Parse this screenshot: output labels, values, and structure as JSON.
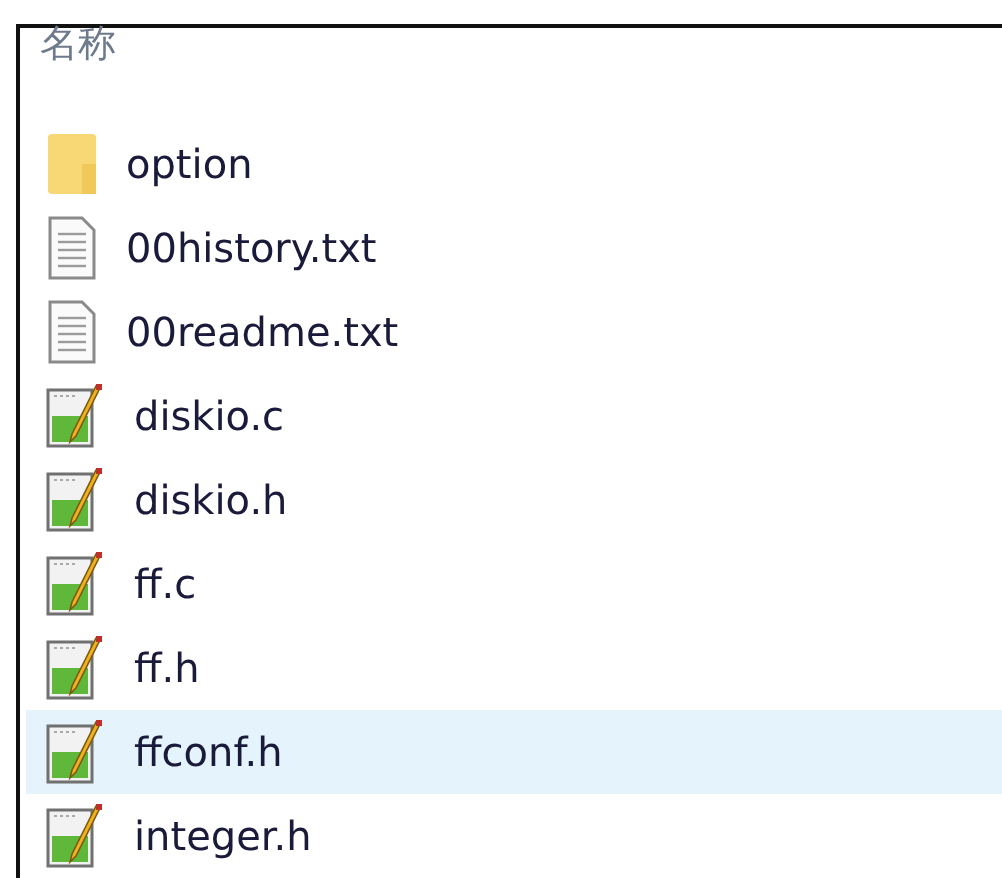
{
  "column_header": "名称",
  "files": [
    {
      "name": "option",
      "kind": "folder",
      "selected": false
    },
    {
      "name": "00history.txt",
      "kind": "text",
      "selected": false
    },
    {
      "name": "00readme.txt",
      "kind": "text",
      "selected": false
    },
    {
      "name": "diskio.c",
      "kind": "source",
      "selected": false
    },
    {
      "name": "diskio.h",
      "kind": "source",
      "selected": false
    },
    {
      "name": "ff.c",
      "kind": "source",
      "selected": false
    },
    {
      "name": "ff.h",
      "kind": "source",
      "selected": false
    },
    {
      "name": "ffconf.h",
      "kind": "source",
      "selected": true
    },
    {
      "name": "integer.h",
      "kind": "source",
      "selected": false
    }
  ]
}
